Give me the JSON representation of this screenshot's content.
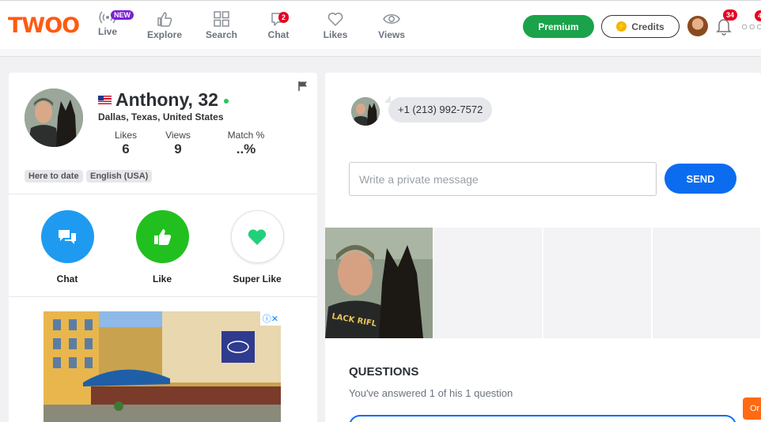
{
  "header": {
    "logo": "TWOO",
    "nav": [
      {
        "label": "Live",
        "badge": "NEW",
        "icon": "live-broadcast-icon"
      },
      {
        "label": "Explore",
        "icon": "thumbs-up-icon"
      },
      {
        "label": "Search",
        "icon": "grid-icon"
      },
      {
        "label": "Chat",
        "badge": "2",
        "icon": "chat-bubble-icon"
      },
      {
        "label": "Likes",
        "icon": "heart-icon"
      },
      {
        "label": "Views",
        "icon": "eye-icon"
      }
    ],
    "premium_label": "Premium",
    "credits_label": "Credits",
    "notifications_count": "34",
    "more_count": "4",
    "accent_green": "#1aa34a",
    "brand_orange": "#ff5a11"
  },
  "profile": {
    "name": "Anthony, 32",
    "location": "Dallas, Texas, United States",
    "stats": [
      {
        "label": "Likes",
        "value": "6"
      },
      {
        "label": "Views",
        "value": "9"
      },
      {
        "label": "Match %",
        "value": "..%"
      }
    ],
    "tags": [
      "Here to date",
      "English (USA)"
    ],
    "actions": [
      {
        "label": "Chat",
        "color": "#1e9bf0",
        "icon": "chat-icon"
      },
      {
        "label": "Like",
        "color": "#22c01e",
        "icon": "thumbs-up-icon"
      },
      {
        "label": "Super Like",
        "color": "#ffffff",
        "icon": "heart-icon"
      }
    ],
    "ad_close": "ⓘ✕"
  },
  "conversation": {
    "phone": "+1 (213) 992-7572",
    "input_placeholder": "Write a private message",
    "send_label": "SEND"
  },
  "photo_overlay_text": "LACK RIFL",
  "questions": {
    "title": "QUESTIONS",
    "subtitle": "You've answered 1 of his 1 question"
  },
  "corner_tab": "Or"
}
